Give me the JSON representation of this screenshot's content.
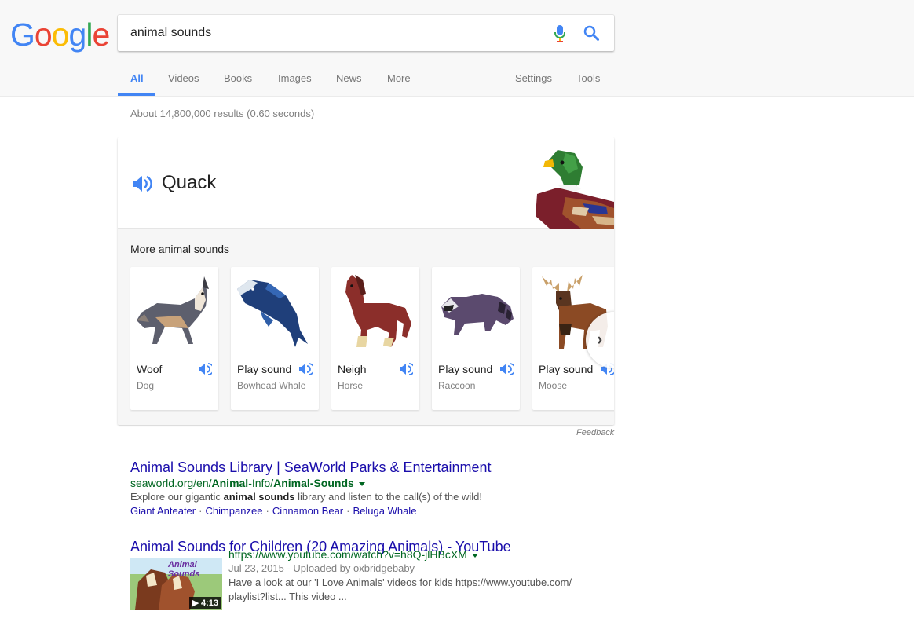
{
  "logo": {
    "letters": [
      "G",
      "o",
      "o",
      "g",
      "l",
      "e"
    ],
    "colors": [
      "#4285f4",
      "#ea4335",
      "#fbbc05",
      "#4285f4",
      "#34a853",
      "#ea4335"
    ]
  },
  "search": {
    "query": "animal sounds"
  },
  "tabs": {
    "all": "All",
    "videos": "Videos",
    "books": "Books",
    "images": "Images",
    "news": "News",
    "more": "More",
    "settings": "Settings",
    "tools": "Tools"
  },
  "stats": "About 14,800,000 results (0.60 seconds)",
  "card": {
    "sound": "Quack",
    "more_title": "More animal sounds",
    "animals": [
      {
        "sound": "Woof",
        "name": "Dog"
      },
      {
        "sound": "Play sound",
        "name": "Bowhead Whale"
      },
      {
        "sound": "Neigh",
        "name": "Horse"
      },
      {
        "sound": "Play sound",
        "name": "Raccoon"
      },
      {
        "sound": "Play sound",
        "name": "Moose"
      }
    ],
    "feedback": "Feedback"
  },
  "results": [
    {
      "title": "Animal Sounds Library | SeaWorld Parks & Entertainment",
      "url_prefix": "seaworld.org/en/",
      "url_b1": "Animal",
      "url_mid": "-Info/",
      "url_b2": "Animal-Sounds",
      "snippet_pre": "Explore our gigantic ",
      "snippet_b": "animal sounds",
      "snippet_post": " library and listen to the call(s) of the wild!",
      "sitelinks": [
        "Giant Anteater",
        "Chimpanzee",
        "Cinnamon Bear",
        "Beluga Whale"
      ]
    },
    {
      "title": "Animal Sounds for Children (20 Amazing Animals) - YouTube",
      "url": "https://www.youtube.com/watch?v=h8Q-jlHBcXM",
      "meta": "Jul 23, 2015 - Uploaded by oxbridgebaby",
      "snippet_line1": "Have a look at our 'I Love Animals' videos for kids https://www.youtube.com/",
      "snippet_line2": "playlist?list... This video ...",
      "thumb_text": "Animal Sounds",
      "duration": "▶ 4:13"
    }
  ]
}
